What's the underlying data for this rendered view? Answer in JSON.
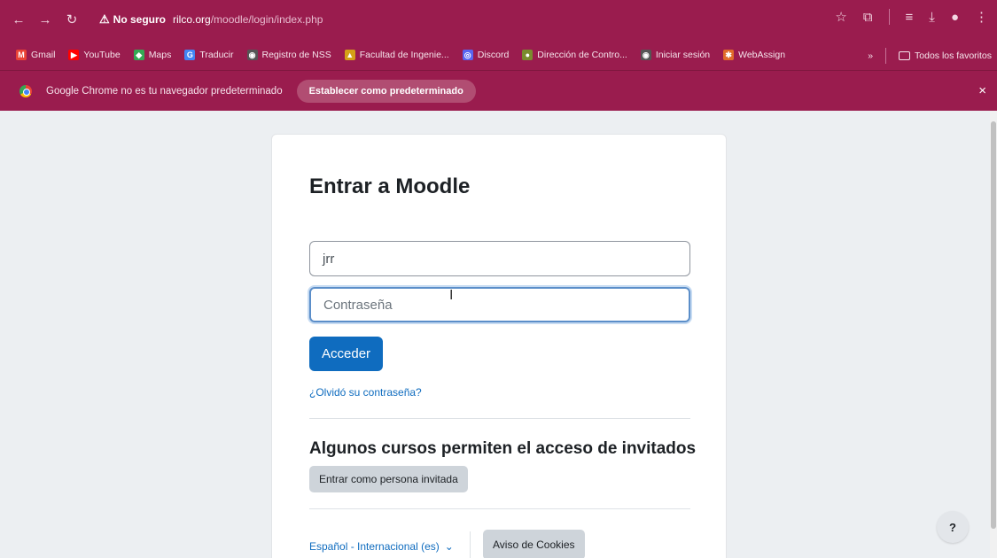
{
  "browser": {
    "security_label": "No seguro",
    "url_host": "rilco.org",
    "url_path": "/moodle/login/index.php",
    "accent_color": "#9a1c4e"
  },
  "bookmarks": [
    {
      "label": "Gmail",
      "icon": "gmail-icon",
      "color": "#ea4335",
      "glyph": "M"
    },
    {
      "label": "YouTube",
      "icon": "youtube-icon",
      "color": "#ff0000",
      "glyph": "▶"
    },
    {
      "label": "Maps",
      "icon": "maps-icon",
      "color": "#34a853",
      "glyph": "◆"
    },
    {
      "label": "Traducir",
      "icon": "translate-icon",
      "color": "#4285f4",
      "glyph": "G"
    },
    {
      "label": "Registro de NSS",
      "icon": "globe-icon",
      "color": "#555555",
      "glyph": "◉"
    },
    {
      "label": "Facultad de Ingenie...",
      "icon": "faculty-icon",
      "color": "#d4a017",
      "glyph": "▲"
    },
    {
      "label": "Discord",
      "icon": "discord-icon",
      "color": "#5865f2",
      "glyph": "◎"
    },
    {
      "label": "Dirección de Contro...",
      "icon": "seal-icon",
      "color": "#7a8b2e",
      "glyph": "●"
    },
    {
      "label": "Iniciar sesión",
      "icon": "globe-icon",
      "color": "#555555",
      "glyph": "◉"
    },
    {
      "label": "WebAssign",
      "icon": "webassign-icon",
      "color": "#e06b2a",
      "glyph": "✱"
    }
  ],
  "bookmarks_more": "»",
  "all_bookmarks_label": "Todos los favoritos",
  "infobar": {
    "message": "Google Chrome no es tu navegador predeterminado",
    "action_label": "Establecer como predeterminado",
    "close": "×"
  },
  "login": {
    "title": "Entrar a Moodle",
    "username_value": "jrr",
    "password_placeholder": "Contraseña",
    "submit_label": "Acceder",
    "forgot_label": "¿Olvidó su contraseña?",
    "guest_heading": "Algunos cursos permiten el acceso de invitados",
    "guest_button": "Entrar como persona invitada",
    "language_label": "Español - Internacional (es)",
    "cookies_button": "Aviso de Cookies",
    "primary_color": "#0f6cbf"
  },
  "help_label": "?"
}
